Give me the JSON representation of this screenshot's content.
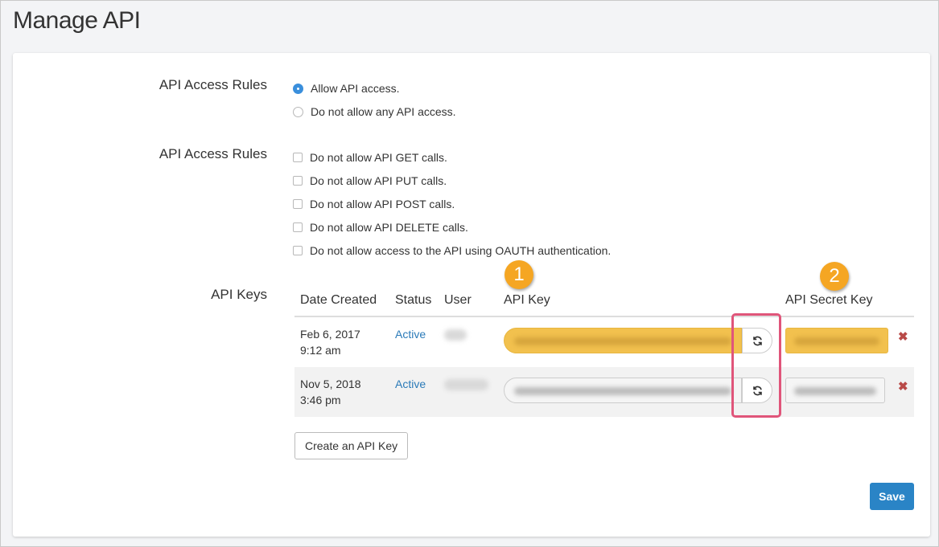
{
  "page": {
    "title": "Manage API"
  },
  "access_rules": {
    "label": "API Access Rules",
    "options": [
      {
        "label": "Allow API access.",
        "checked": true
      },
      {
        "label": "Do not allow any API access.",
        "checked": false
      }
    ]
  },
  "call_rules": {
    "label": "API Access Rules",
    "options": [
      {
        "label": "Do not allow API GET calls.",
        "checked": false
      },
      {
        "label": "Do not allow API PUT calls.",
        "checked": false
      },
      {
        "label": "Do not allow API POST calls.",
        "checked": false
      },
      {
        "label": "Do not allow API DELETE calls.",
        "checked": false
      },
      {
        "label": "Do not allow access to the API using OAUTH authentication.",
        "checked": false
      }
    ]
  },
  "api_keys": {
    "label": "API Keys",
    "columns": [
      "Date Created",
      "Status",
      "User",
      "API Key",
      "API Secret Key"
    ],
    "rows": [
      {
        "date": "Feb 6, 2017",
        "time": "9:12 am",
        "status": "Active",
        "highlighted": true
      },
      {
        "date": "Nov 5, 2018",
        "time": "3:46 pm",
        "status": "Active",
        "highlighted": false
      }
    ],
    "create_button": "Create an API Key"
  },
  "callouts": {
    "badge_1": "1",
    "badge_2": "2"
  },
  "actions": {
    "save": "Save"
  },
  "colors": {
    "accent": "#2a84c6",
    "link": "#2a7ab8",
    "highlight": "#f2c14e",
    "callout_border": "#e0557a",
    "badge": "#f5a623",
    "delete": "#b94a48"
  },
  "icons": {
    "refresh": "refresh-icon",
    "delete": "delete-x-icon"
  }
}
